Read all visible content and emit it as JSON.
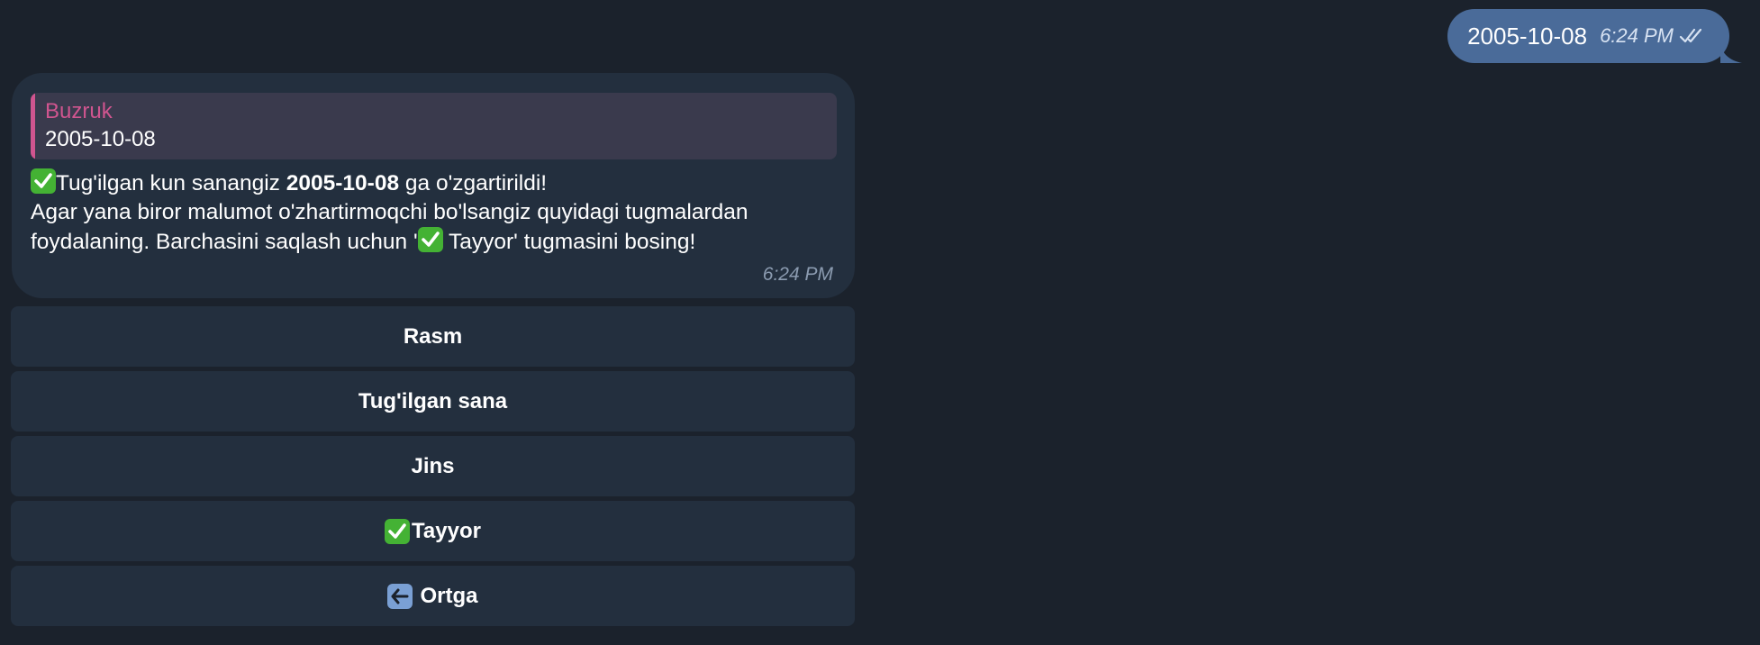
{
  "outgoing": {
    "text": "2005-10-08",
    "time": "6:24 PM",
    "status_icon": "double-check-icon"
  },
  "incoming": {
    "reply": {
      "author": "Buzruk",
      "text": "2005-10-08"
    },
    "line1_prefix": "Tug'ilgan kun sanangiz  ",
    "line1_bold": "2005-10-08",
    "line1_suffix": " ga o'zgartirildi!",
    "line2": "Agar yana biror malumot o'zhartirmoqchi bo'lsangiz quyidagi tugmalardan",
    "line3_prefix": "foydalaning. Barchasini saqlash uchun '",
    "line3_suffix": " Tayyor' tugmasini bosing!",
    "time": "6:24 PM"
  },
  "keyboard": {
    "buttons": [
      {
        "label": "Rasm"
      },
      {
        "label": "Tug'ilgan sana"
      },
      {
        "label": "Jins"
      },
      {
        "label": "Tayyor",
        "icon": "check-mark-emoji-icon"
      },
      {
        "label": " Ortga",
        "icon": "left-arrow-emoji-icon"
      }
    ]
  },
  "colors": {
    "background": "#1b222c",
    "outgoing_bubble": "#4a6b99",
    "incoming_bubble": "#232f3e",
    "reply_accent": "#d0558f",
    "check_emoji": "#44b234"
  }
}
